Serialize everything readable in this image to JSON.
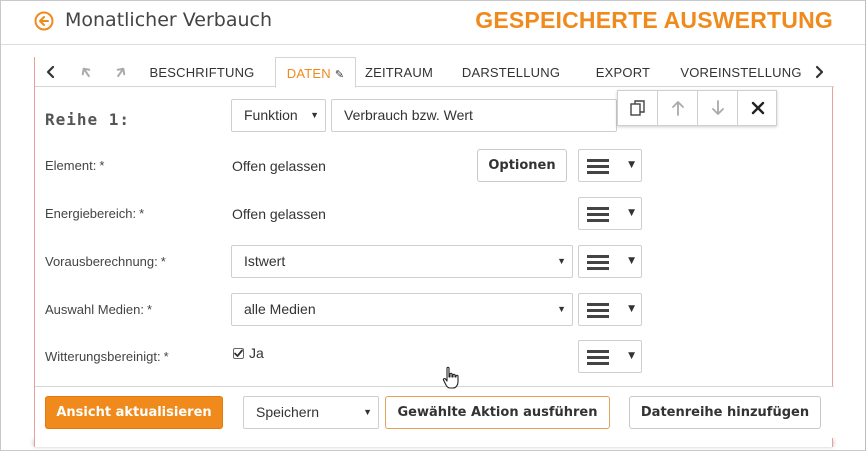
{
  "header": {
    "title": "Monatlicher Verbauch",
    "brand": "GESPEICHERTE AUSWERTUNG",
    "accent_color": "#f08a1c"
  },
  "tabs": [
    {
      "label": "BESCHRIFTUNG",
      "active": false
    },
    {
      "label": "DATEN",
      "active": true
    },
    {
      "label": "ZEITRAUM",
      "active": false
    },
    {
      "label": "DARSTELLUNG",
      "active": false
    },
    {
      "label": "EXPORT",
      "active": false
    },
    {
      "label": "VOREINSTELLUNG",
      "active": false
    }
  ],
  "tab_controls": {
    "prev_icon": "chevron-left-icon",
    "undo_icon": "undo-icon",
    "redo_icon": "redo-icon",
    "next_icon": "chevron-right-icon",
    "pin_icon": "pin-icon"
  },
  "series": {
    "label": "Reihe 1:",
    "type_select": "Funktion",
    "value_select": "Verbrauch bzw. Wert"
  },
  "toolbox": {
    "copy_icon": "copy-icon",
    "up_icon": "arrow-up-icon",
    "down_icon": "arrow-down-icon",
    "close_icon": "close-icon"
  },
  "fields": {
    "element": {
      "label": "Element:",
      "value": "Offen gelassen",
      "options_button": "Optionen"
    },
    "energiebereich": {
      "label": "Energiebereich:",
      "value": "Offen gelassen"
    },
    "vorausberechnung": {
      "label": "Vorausberechnung:",
      "value": "Istwert"
    },
    "medien": {
      "label": "Auswahl Medien:",
      "value": "alle Medien"
    },
    "witterung": {
      "label": "Witterungsbereinigt:",
      "checked": true,
      "check_label": "Ja"
    },
    "required_mark": "*"
  },
  "footer": {
    "refresh_button": "Ansicht aktualisieren",
    "action_select": "Speichern",
    "execute_button": "Gewählte Aktion ausführen",
    "add_series_button": "Datenreihe hinzufügen"
  }
}
